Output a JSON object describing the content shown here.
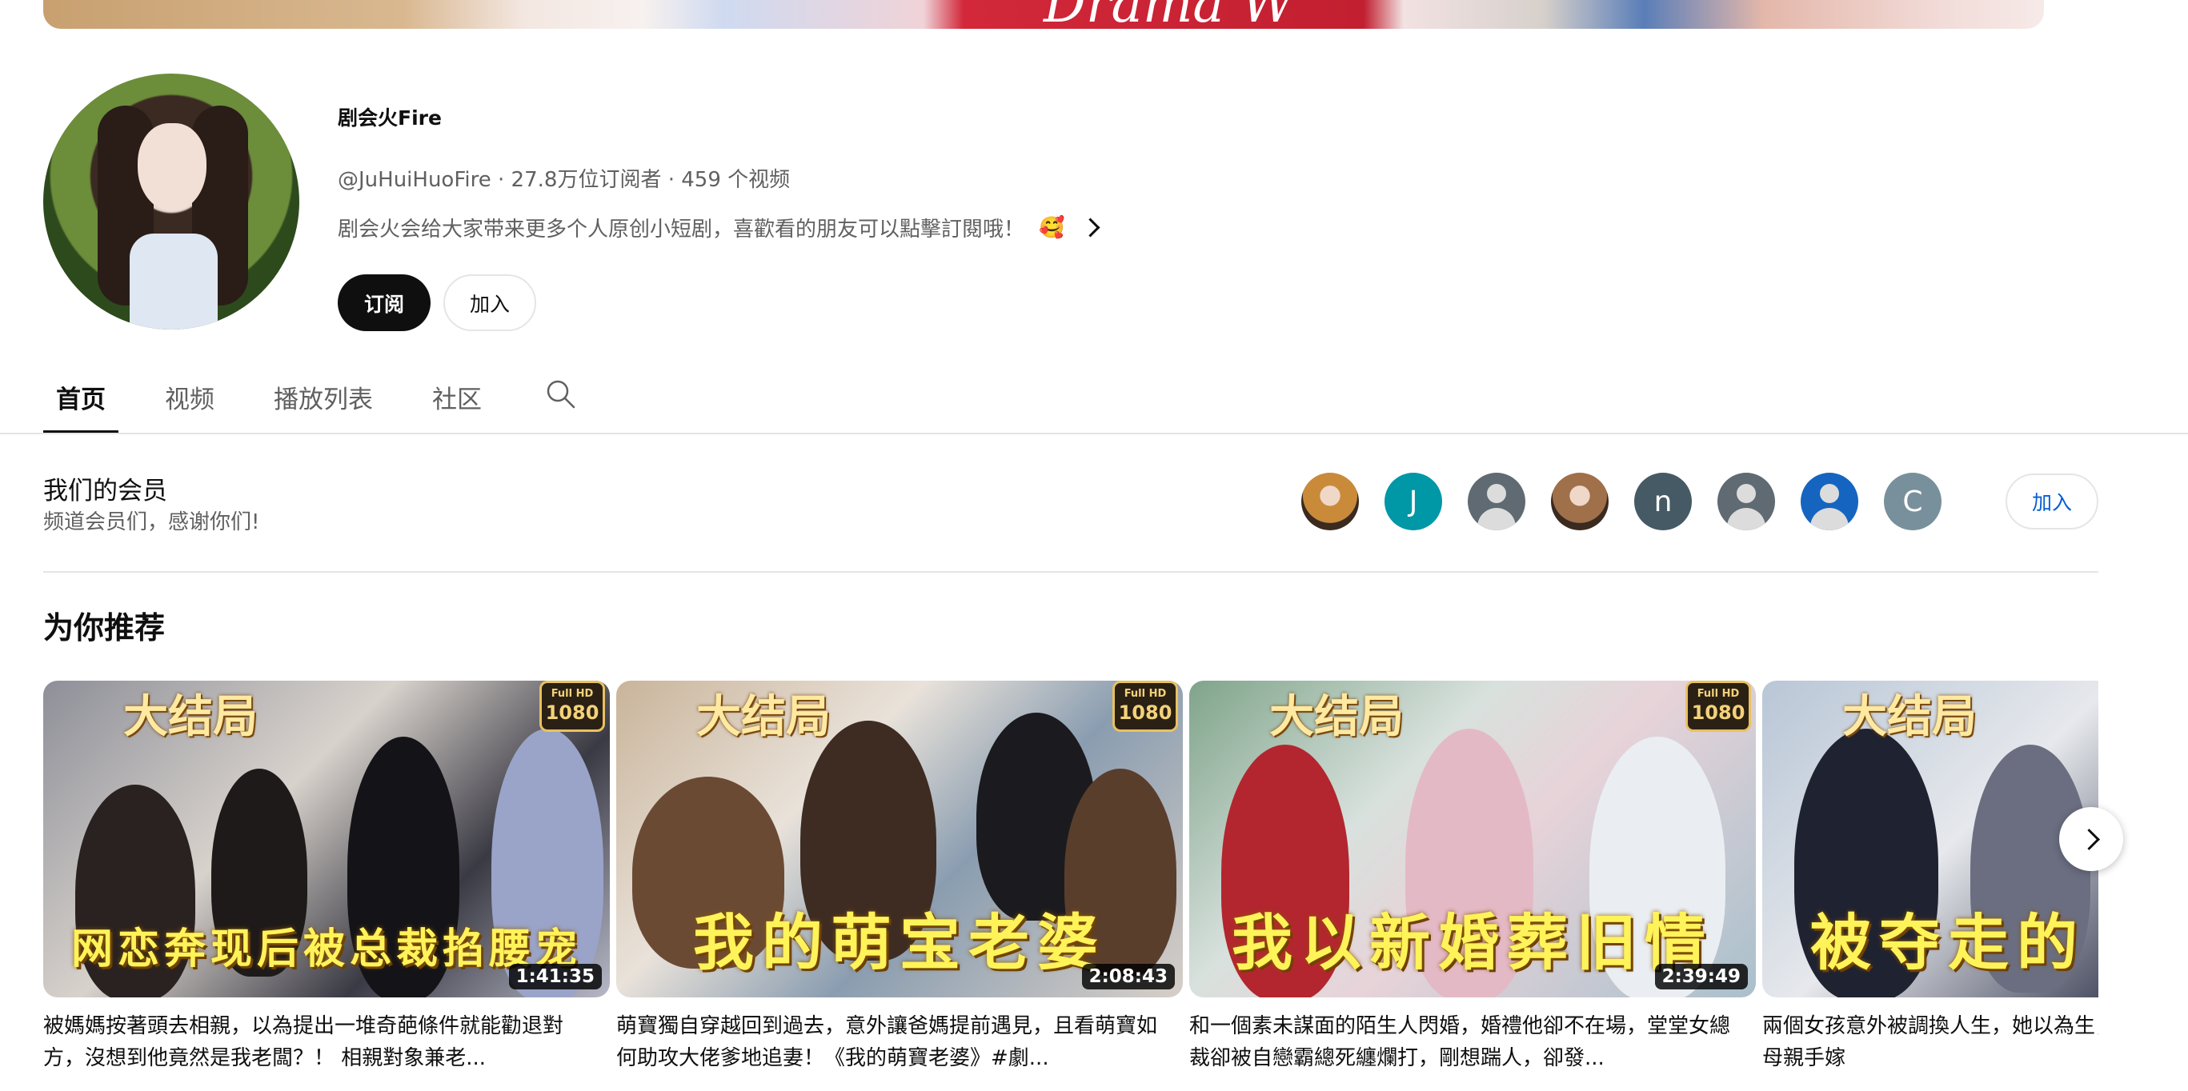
{
  "banner": {
    "text": "Drama W"
  },
  "channel": {
    "name": "剧会火Fire",
    "handle": "@JuHuiHuoFire",
    "subscribers": "27.8万位订阅者",
    "videos": "459 个视频",
    "separator": "·",
    "description": "剧会火会给大家带来更多个人原创小短剧，喜歡看的朋友可以點擊訂閱哦！",
    "description_emoji": "🥰",
    "subscribe_label": "订阅",
    "join_label": "加入"
  },
  "tabs": [
    {
      "label": "首页",
      "active": true
    },
    {
      "label": "视频",
      "active": false
    },
    {
      "label": "播放列表",
      "active": false
    },
    {
      "label": "社区",
      "active": false
    }
  ],
  "members": {
    "title": "我们的会员",
    "subtitle": "频道会员们，感谢你们!",
    "join_label": "加入",
    "avatars": [
      {
        "type": "photo",
        "color": "#c98a3a"
      },
      {
        "type": "letter",
        "letter": "J",
        "color": "#0097a7"
      },
      {
        "type": "default",
        "color": "#5f6a72"
      },
      {
        "type": "photo",
        "color": "#a0704a"
      },
      {
        "type": "letter",
        "letter": "n",
        "color": "#455a64"
      },
      {
        "type": "default",
        "color": "#5f6a72"
      },
      {
        "type": "default",
        "color": "#1565c0"
      },
      {
        "type": "letter",
        "letter": "C",
        "color": "#78909c"
      }
    ]
  },
  "recommended": {
    "title": "为你推荐",
    "badge_end": "大结局",
    "badge_hd_top": "Full HD",
    "badge_hd_bottom": "1080",
    "videos": [
      {
        "thumb_title": "网恋奔现后被总裁掐腰宠",
        "duration": "1:41:35",
        "title": "被媽媽按著頭去相親，以為提出一堆奇葩條件就能勸退對方，沒想到他竟然是我老闆？！ 相親對象兼老..."
      },
      {
        "thumb_title": "我的萌宝老婆",
        "duration": "2:08:43",
        "title": "萌寶獨自穿越回到過去，意外讓爸媽提前遇見，且看萌寶如何助攻大佬爹地追妻！《我的萌寶老婆》#劇..."
      },
      {
        "thumb_title": "我以新婚葬旧情",
        "duration": "2:39:49",
        "title": "和一個素未謀面的陌生人閃婚，婚禮他卻不在場，堂堂女總裁卻被自戀霸總死纏爛打，剛想踹人，卻發..."
      },
      {
        "thumb_title": "被夺走的",
        "duration": "",
        "title": "兩個女孩意外被調換人生，她以為生，百般愧疚，卻被養父母親手嫁"
      }
    ]
  }
}
